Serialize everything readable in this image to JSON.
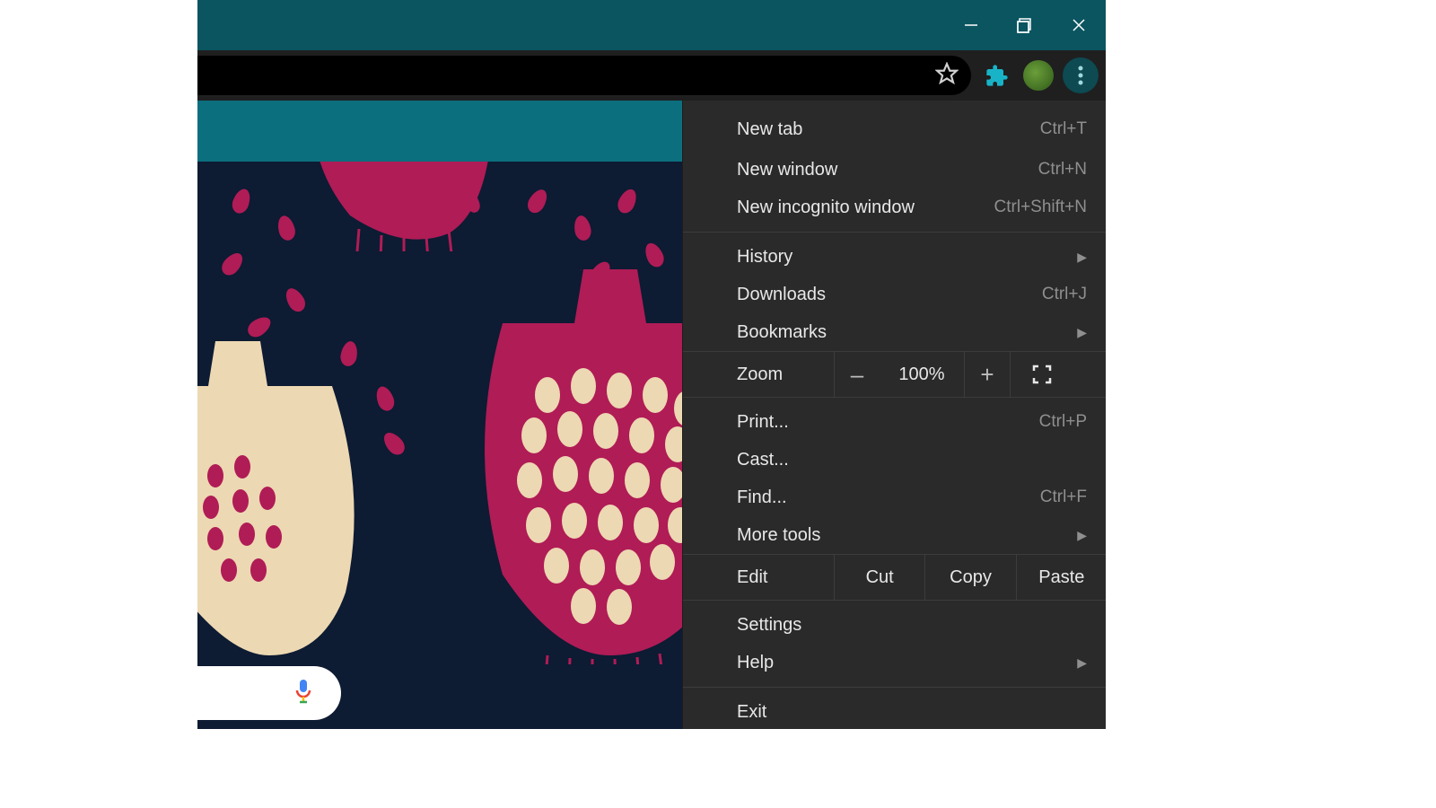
{
  "window_controls": {
    "minimize": "minimize",
    "maximize": "maximize",
    "close": "close"
  },
  "toolbar": {
    "star": "bookmark-star",
    "extensions": "extensions",
    "profile": "profile",
    "more": "more"
  },
  "menu": {
    "new_tab": {
      "label": "New tab",
      "shortcut": "Ctrl+T"
    },
    "new_window": {
      "label": "New window",
      "shortcut": "Ctrl+N"
    },
    "new_incognito": {
      "label": "New incognito window",
      "shortcut": "Ctrl+Shift+N"
    },
    "history": {
      "label": "History"
    },
    "downloads": {
      "label": "Downloads",
      "shortcut": "Ctrl+J"
    },
    "bookmarks": {
      "label": "Bookmarks"
    },
    "zoom": {
      "label": "Zoom",
      "minus": "–",
      "value": "100%",
      "plus": "+"
    },
    "print": {
      "label": "Print...",
      "shortcut": "Ctrl+P"
    },
    "cast": {
      "label": "Cast..."
    },
    "find": {
      "label": "Find...",
      "shortcut": "Ctrl+F"
    },
    "more_tools": {
      "label": "More tools"
    },
    "edit": {
      "label": "Edit",
      "cut": "Cut",
      "copy": "Copy",
      "paste": "Paste"
    },
    "settings": {
      "label": "Settings"
    },
    "help": {
      "label": "Help"
    },
    "exit": {
      "label": "Exit"
    }
  }
}
